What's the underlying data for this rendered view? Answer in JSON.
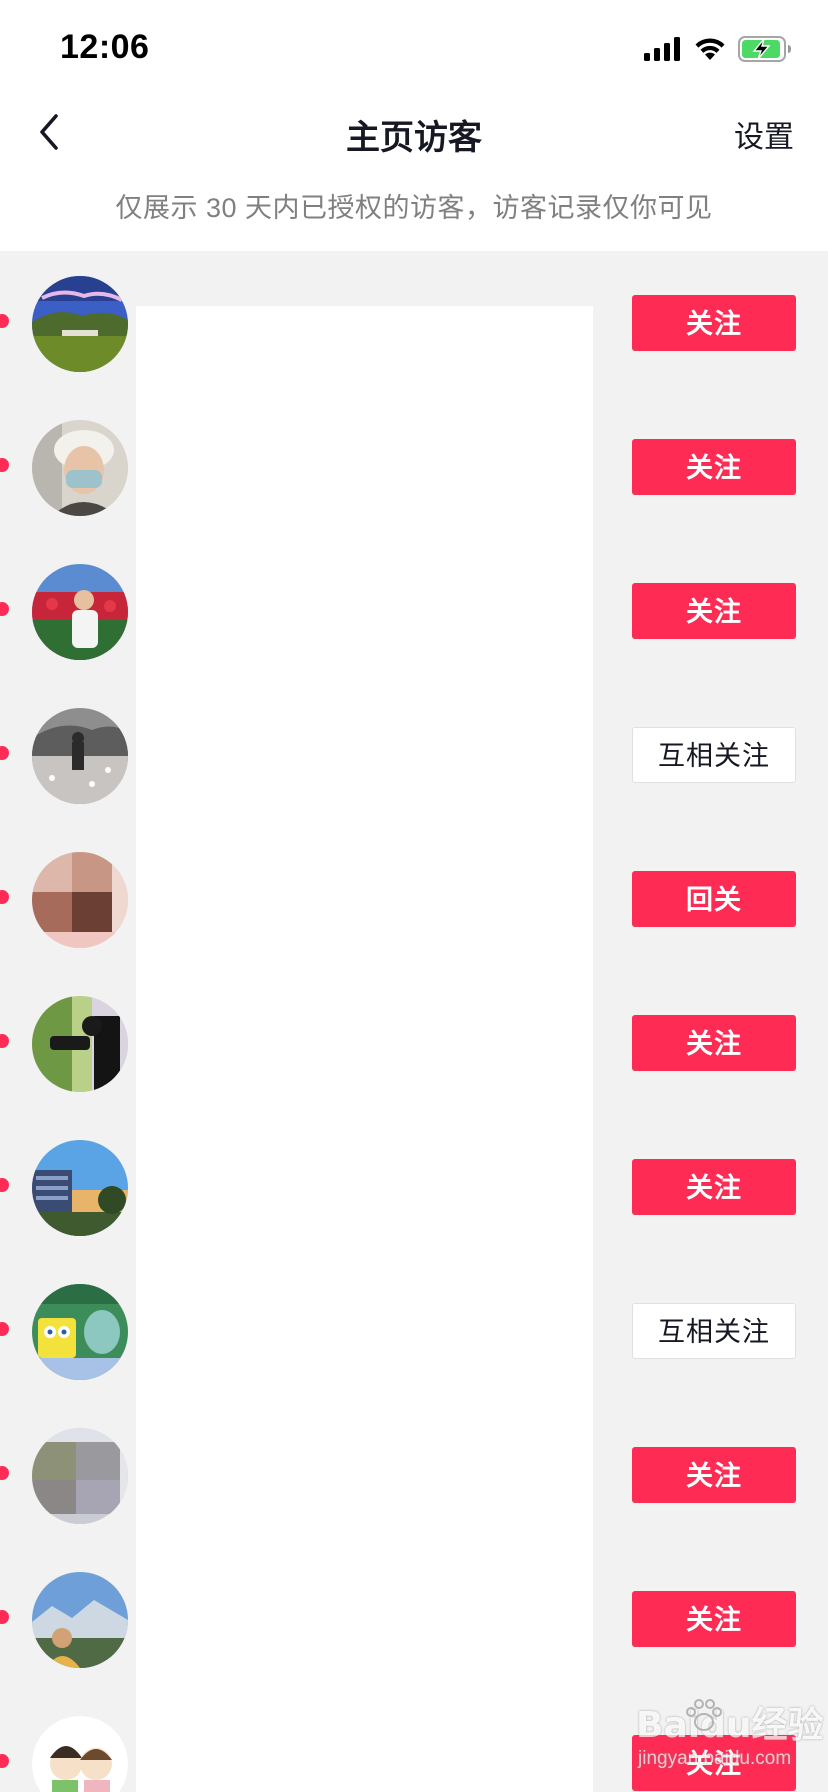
{
  "status_bar": {
    "time": "12:06",
    "icons": [
      "cellular-signal-icon",
      "wifi-icon",
      "battery-charging-icon"
    ],
    "battery_color": "#4cd964"
  },
  "nav": {
    "back_icon": "chevron-left-icon",
    "title": "主页访客",
    "settings_label": "设置"
  },
  "notice": "仅展示 30 天内已授权的访客，访客记录仅你可见",
  "colors": {
    "accent": "#fe2c55",
    "list_background": "#f2f2f2",
    "notice_text": "#808080"
  },
  "visitors": [
    {
      "avatar": "landscape-photo-avatar",
      "unread": true,
      "button": "关注",
      "style": "primary"
    },
    {
      "avatar": "person-with-mask-avatar",
      "unread": true,
      "button": "关注",
      "style": "primary"
    },
    {
      "avatar": "person-flowers-avatar",
      "unread": true,
      "button": "关注",
      "style": "primary"
    },
    {
      "avatar": "person-field-avatar",
      "unread": true,
      "button": "互相关注",
      "style": "mutual"
    },
    {
      "avatar": "pixelated-face-avatar",
      "unread": true,
      "button": "回关",
      "style": "primary"
    },
    {
      "avatar": "photographer-avatar",
      "unread": true,
      "button": "关注",
      "style": "primary"
    },
    {
      "avatar": "sunset-building-avatar",
      "unread": true,
      "button": "关注",
      "style": "primary"
    },
    {
      "avatar": "cartoon-avatar",
      "unread": true,
      "button": "互相关注",
      "style": "mutual"
    },
    {
      "avatar": "pixelated-avatar",
      "unread": true,
      "button": "关注",
      "style": "primary"
    },
    {
      "avatar": "mountain-person-avatar",
      "unread": true,
      "button": "关注",
      "style": "primary"
    },
    {
      "avatar": "cartoon-couple-avatar",
      "unread": true,
      "button": "关注",
      "style": "primary"
    }
  ],
  "watermark": {
    "logo": "Baidu经验",
    "url": "jingyan.baidu.com"
  }
}
